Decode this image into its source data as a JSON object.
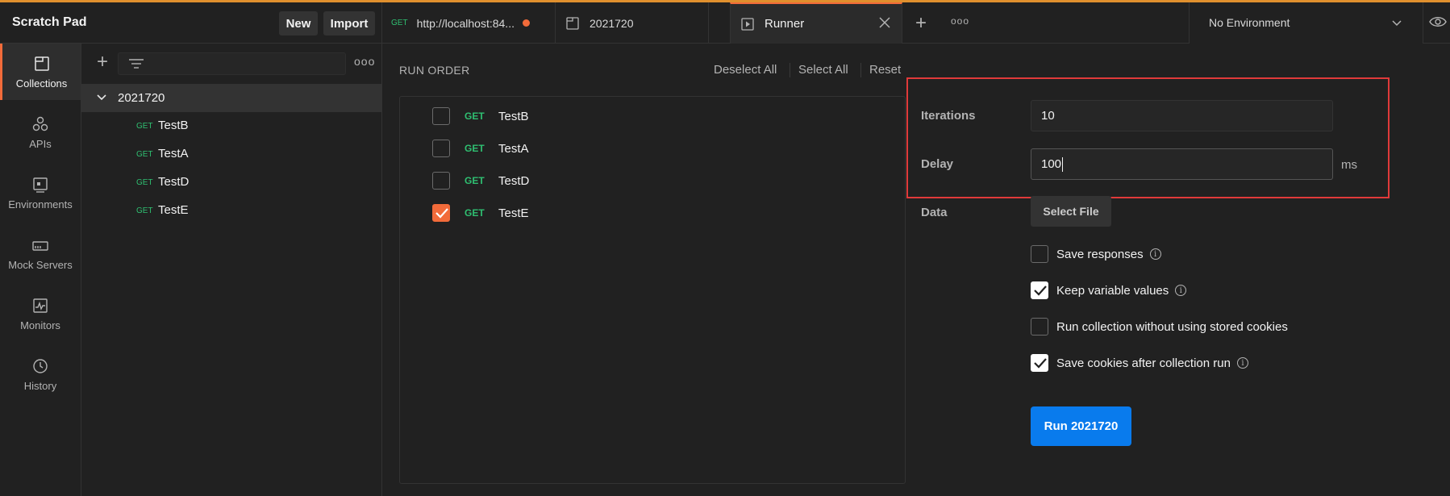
{
  "workspace": {
    "title": "Scratch Pad",
    "new_label": "New",
    "import_label": "Import"
  },
  "nav": [
    {
      "label": "Collections",
      "icon": "collections-icon",
      "active": true
    },
    {
      "label": "APIs",
      "icon": "apis-icon"
    },
    {
      "label": "Environments",
      "icon": "environments-icon"
    },
    {
      "label": "Mock Servers",
      "icon": "mock-servers-icon"
    },
    {
      "label": "Monitors",
      "icon": "monitors-icon"
    },
    {
      "label": "History",
      "icon": "history-icon"
    }
  ],
  "sidebar": {
    "more": "ooo",
    "collection": {
      "name": "2021720",
      "expanded": true
    },
    "requests": [
      {
        "method": "GET",
        "name": "TestB"
      },
      {
        "method": "GET",
        "name": "TestA"
      },
      {
        "method": "GET",
        "name": "TestD"
      },
      {
        "method": "GET",
        "name": "TestE"
      }
    ]
  },
  "tabs": [
    {
      "method": "GET",
      "title": "http://localhost:84...",
      "unsaved": true
    },
    {
      "title": "2021720"
    },
    {
      "title": "Runner",
      "active": true
    }
  ],
  "tabbar": {
    "more": "ooo"
  },
  "environment": {
    "label": "No Environment"
  },
  "runner": {
    "run_order_label": "RUN ORDER",
    "deselect_all": "Deselect All",
    "select_all": "Select All",
    "reset": "Reset",
    "items": [
      {
        "method": "GET",
        "name": "TestB",
        "checked": false
      },
      {
        "method": "GET",
        "name": "TestA",
        "checked": false
      },
      {
        "method": "GET",
        "name": "TestD",
        "checked": false
      },
      {
        "method": "GET",
        "name": "TestE",
        "checked": true
      }
    ],
    "iterations_label": "Iterations",
    "iterations_value": "10",
    "delay_label": "Delay",
    "delay_value": "100",
    "delay_unit": "ms",
    "data_label": "Data",
    "select_file": "Select File",
    "options": [
      {
        "label": "Save responses",
        "checked": false,
        "info": true
      },
      {
        "label": "Keep variable values",
        "checked": true,
        "info": true
      },
      {
        "label": "Run collection without using stored cookies",
        "checked": false,
        "info": false
      },
      {
        "label": "Save cookies after collection run",
        "checked": true,
        "info": true
      }
    ],
    "run_button": "Run 2021720"
  },
  "colors": {
    "accent": "#f26b3a",
    "get": "#2fbf71",
    "primary": "#097bed",
    "highlight": "#e03a3a"
  }
}
